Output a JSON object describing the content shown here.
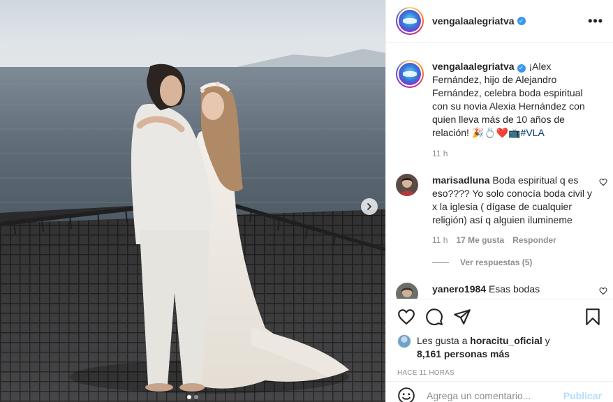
{
  "post": {
    "author": "vengalaalegriatva",
    "more_icon_label": "•••"
  },
  "caption": {
    "username": "vengalaalegriatva",
    "text": "¡Alex Fernández, hijo de Alejandro Fernández, celebra boda espiritual con su novia Alexia Hernández con quien lleva más de 10 años de relación! 🎉💍❤️📺",
    "hashtag": "#VLA",
    "time": "11 h"
  },
  "comments": [
    {
      "username": "marisadluna",
      "text": "Boda espiritual q es eso???? Yo solo conocía boda civil y x la iglesia ( dígase de cualquier religión) así q alguien ilumineme",
      "time": "11 h",
      "likes": "17 Me gusta",
      "reply_label": "Responder",
      "view_replies": "Ver respuestas (5)"
    },
    {
      "username": "yanero1984",
      "text": "Esas bodas “espirituales” duran muy poco xd,"
    }
  ],
  "likes": {
    "prefix": "Les gusta a",
    "liker": "horacitu_oficial",
    "conj": "y",
    "others": "8,161 personas más"
  },
  "timestamp": "HACE 11 HORAS",
  "add_comment": {
    "placeholder": "Agrega un comentario...",
    "publish": "Publicar"
  },
  "colors": {
    "link": "#00376b",
    "verified": "#3897f0",
    "publish_disabled": "#b2dffc",
    "muted": "#8e8e8e"
  }
}
